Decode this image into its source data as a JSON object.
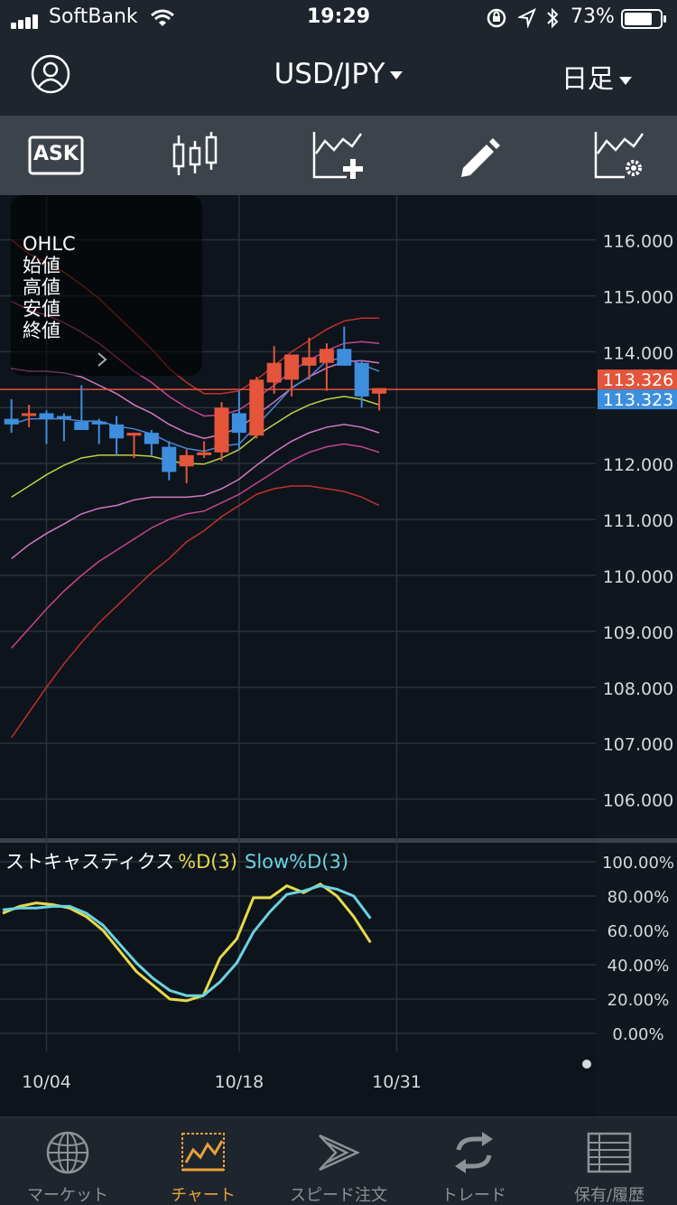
{
  "status": {
    "carrier": "SoftBank",
    "time": "19:29",
    "battery": "73%"
  },
  "header": {
    "pair": "USD/JPY",
    "timeframe": "日足",
    "user_icon": "user-circle-icon"
  },
  "toolbar": {
    "ask_label": "ASK",
    "icons": [
      "ask-icon",
      "candlestick-icon",
      "add-indicator-icon",
      "pencil-icon",
      "indicator-settings-icon"
    ]
  },
  "ohlc": {
    "title": "OHLC",
    "open": "始値",
    "high": "高値",
    "low": "安値",
    "close": "終値",
    "chevron": "chevron-right-icon"
  },
  "price_axis": {
    "labels": [
      "116.000",
      "115.000",
      "114.000",
      "112.000",
      "111.000",
      "110.000",
      "109.000",
      "108.000",
      "107.000",
      "106.000"
    ],
    "ask_badge": "113.326",
    "bid_badge": "113.323"
  },
  "stochastics": {
    "title": "ストキャスティクス",
    "d_label": "%D(3)",
    "slow_label": "Slow%D(3)",
    "axis_labels": [
      "100.00%",
      "80.00%",
      "60.00%",
      "40.00%",
      "20.00%",
      "0.00%"
    ]
  },
  "date_axis": {
    "labels": [
      "10/04",
      "10/18",
      "10/31"
    ]
  },
  "colors": {
    "up": "#e4553b",
    "down": "#3d8fde",
    "d_line": "#e6d94a",
    "slow_line": "#6ad3e0",
    "accent": "#e9a13b"
  },
  "tabs": [
    {
      "label": "マーケット",
      "icon": "globe-icon",
      "active": false
    },
    {
      "label": "チャート",
      "icon": "chart-icon",
      "active": true
    },
    {
      "label": "スピード注文",
      "icon": "speed-order-icon",
      "active": false
    },
    {
      "label": "トレード",
      "icon": "trade-icon",
      "active": false
    },
    {
      "label": "保有/履歴",
      "icon": "positions-icon",
      "active": false
    }
  ],
  "chart_data": [
    {
      "type": "candlestick",
      "x_ticks": [
        "10/04",
        "10/18",
        "10/31"
      ],
      "ylim": [
        105.3,
        116.8
      ],
      "last_price": 113.326,
      "candles": [
        {
          "o": 112.8,
          "h": 113.15,
          "l": 112.55,
          "c": 112.7
        },
        {
          "o": 112.85,
          "h": 113.05,
          "l": 112.65,
          "c": 112.9
        },
        {
          "o": 112.9,
          "h": 112.95,
          "l": 112.35,
          "c": 112.8
        },
        {
          "o": 112.85,
          "h": 112.9,
          "l": 112.4,
          "c": 112.8
        },
        {
          "o": 112.75,
          "h": 113.4,
          "l": 112.7,
          "c": 112.6
        },
        {
          "o": 112.75,
          "h": 112.8,
          "l": 112.35,
          "c": 112.7
        },
        {
          "o": 112.7,
          "h": 112.85,
          "l": 112.15,
          "c": 112.45
        },
        {
          "o": 112.5,
          "h": 112.55,
          "l": 112.1,
          "c": 112.55
        },
        {
          "o": 112.55,
          "h": 112.6,
          "l": 112.15,
          "c": 112.35
        },
        {
          "o": 112.3,
          "h": 112.4,
          "l": 111.7,
          "c": 111.85
        },
        {
          "o": 111.95,
          "h": 112.25,
          "l": 111.65,
          "c": 112.15
        },
        {
          "o": 112.15,
          "h": 112.4,
          "l": 112.1,
          "c": 112.2
        },
        {
          "o": 112.2,
          "h": 113.1,
          "l": 112.05,
          "c": 113.0
        },
        {
          "o": 112.9,
          "h": 113.3,
          "l": 112.25,
          "c": 112.55
        },
        {
          "o": 112.5,
          "h": 113.55,
          "l": 112.45,
          "c": 113.5
        },
        {
          "o": 113.45,
          "h": 114.1,
          "l": 113.25,
          "c": 113.8
        },
        {
          "o": 113.5,
          "h": 113.95,
          "l": 113.2,
          "c": 113.95
        },
        {
          "o": 113.75,
          "h": 114.25,
          "l": 113.5,
          "c": 113.9
        },
        {
          "o": 113.8,
          "h": 114.15,
          "l": 113.3,
          "c": 114.05
        },
        {
          "o": 114.05,
          "h": 114.45,
          "l": 113.75,
          "c": 113.75
        },
        {
          "o": 113.8,
          "h": 113.85,
          "l": 113.0,
          "c": 113.2
        },
        {
          "o": 113.25,
          "h": 113.3,
          "l": 112.95,
          "c": 113.35
        }
      ]
    },
    {
      "type": "line",
      "title": "ストキャスティクス",
      "ylim": [
        0,
        100
      ],
      "series": [
        {
          "name": "%D(3)",
          "values": [
            70,
            74,
            76,
            75,
            73,
            68,
            60,
            48,
            36,
            28,
            20,
            19,
            22,
            44,
            55,
            79,
            79,
            86,
            82,
            87,
            80,
            68,
            53
          ]
        },
        {
          "name": "Slow%D(3)",
          "values": [
            72,
            73,
            73,
            74,
            74,
            70,
            63,
            52,
            41,
            32,
            25,
            22,
            22,
            30,
            41,
            59,
            71,
            81,
            83,
            86,
            84,
            80,
            67
          ]
        }
      ]
    }
  ]
}
